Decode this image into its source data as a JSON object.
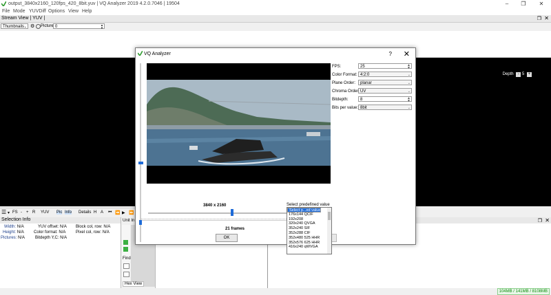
{
  "window": {
    "title": "output_3840x2160_120fps_420_8bit.yuv | VQ Analyzer 2019 4.2.0.7046 | 19504",
    "minimize": "–",
    "maximize": "❐",
    "close": "✕"
  },
  "menu": [
    "File",
    "Mode",
    "YUVDiff",
    "Options",
    "View",
    "Help"
  ],
  "stream_view": {
    "label": "Stream View | YUV |",
    "thumbnails": "Thumbnails",
    "picture_label": "Picture:",
    "picture_value": "0"
  },
  "depth": {
    "label": "Depth",
    "value": "5"
  },
  "bottom_toolbar": {
    "items": [
      "FS",
      "-",
      "+",
      "R",
      "YUV",
      "Pic",
      "Info",
      "Details",
      "H",
      "A"
    ]
  },
  "selection_info": {
    "title": "Selection Info",
    "width_label": "Width:",
    "width_value": "N/A",
    "height_label": "Height:",
    "height_value": "N/A",
    "pictures_label": "Pictures:",
    "pictures_value": "N/A",
    "yuv_offset_label": "YUV offset:",
    "yuv_offset_value": "N/A",
    "color_format_label": "Color format:",
    "color_format_value": "N/A",
    "bitdepth_label": "Bitdepth Y,C:",
    "bitdepth_value": "N/A",
    "block_label": "Block col, row:",
    "block_value": "N/A",
    "pixel_label": "Pixel col, row:",
    "pixel_value": "N/A"
  },
  "unit_info": {
    "title": "Unit In",
    "find": "Find",
    "hex_view": "Hex View"
  },
  "memory": "104MB / 141MB / 8108MB",
  "dialog": {
    "title": "VQ Analyzer",
    "help": "?",
    "close": "✕",
    "fields": {
      "fps_label": "FPS:",
      "fps_value": "25",
      "color_format_label": "Color Format:",
      "color_format_value": "4:2:0",
      "plane_order_label": "Plane Order:",
      "plane_order_value": "planar",
      "chroma_order_label": "Chroma Order:",
      "chroma_order_value": "UV",
      "bitdepth_label": "Bitdepth:",
      "bitdepth_value": "8",
      "bits_per_value_label": "Bits per value:",
      "bits_per_value_value": "8bit"
    },
    "dimensions": "3840  x  2160",
    "frames": "21 frames",
    "ok": "OK"
  },
  "predefined": {
    "label": "Select predefined value",
    "items": [
      "Select p...ed value",
      "128x96    SQCIF",
      "176x144   QCIF",
      "192x208",
      "320x240   QVGA",
      "352x240   SIF",
      "352x288   CIF",
      "352x480   525 HHR",
      "352x576   625 HHR",
      "416x240   qWVGA"
    ]
  }
}
